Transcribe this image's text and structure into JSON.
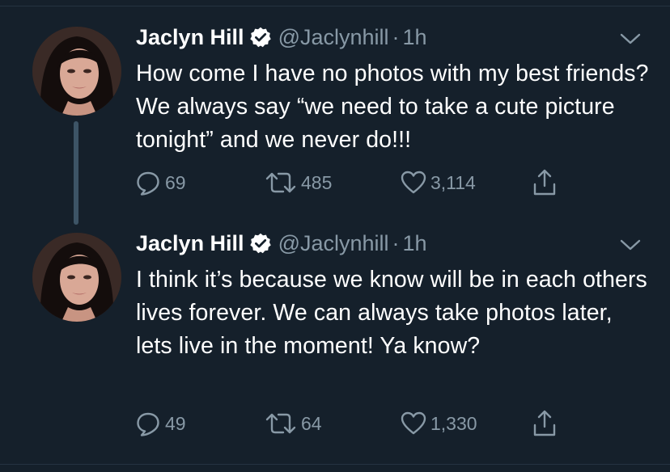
{
  "tweets": [
    {
      "name": "Jaclyn Hill",
      "handle": "@Jaclynhill",
      "separator": "·",
      "time": "1h",
      "text": "How come I have no photos with my best friends? We always say “we need to take a cute picture tonight” and we never do!!!",
      "replies": "69",
      "retweets": "485",
      "likes": "3,114"
    },
    {
      "name": "Jaclyn Hill",
      "handle": "@Jaclynhill",
      "separator": "·",
      "time": "1h",
      "text": "I think it’s because we know will be in each others lives forever. We can always take photos later, lets live in the moment! Ya know?",
      "replies": "49",
      "retweets": "64",
      "likes": "1,330"
    }
  ],
  "icons": {
    "verified": "verified-badge-icon",
    "menu": "chevron-down-icon",
    "reply": "reply-icon",
    "retweet": "retweet-icon",
    "like": "heart-icon",
    "share": "share-icon"
  },
  "colors": {
    "background": "#15202b",
    "text": "#ffffff",
    "secondary": "#8899a6",
    "thread_line": "#3d5466",
    "border": "#253341"
  }
}
